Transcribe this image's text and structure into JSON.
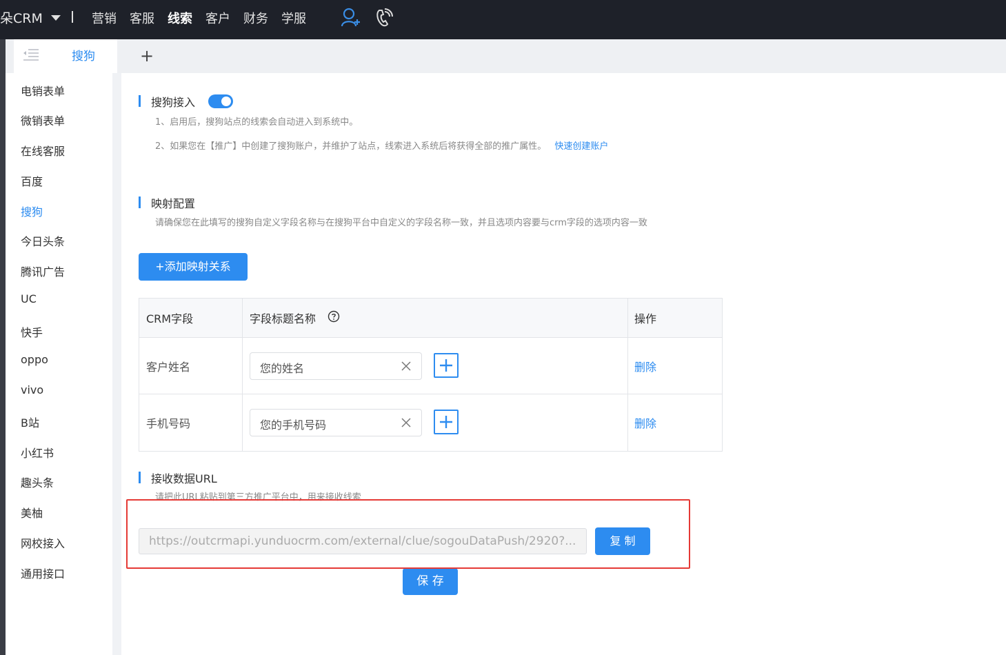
{
  "header": {
    "brand": "朵CRM",
    "nav": [
      "营销",
      "客服",
      "线索",
      "客户",
      "财务",
      "学服"
    ],
    "active_nav": "线索",
    "icons": [
      "add-user-icon",
      "phone-icon"
    ]
  },
  "tabs": {
    "active_label": "搜狗",
    "add_label": "+"
  },
  "sidebar": {
    "items": [
      "电销表单",
      "微销表单",
      "在线客服",
      "百度",
      "搜狗",
      "今日头条",
      "腾讯广告",
      "UC",
      "快手",
      "oppo",
      "vivo",
      "B站",
      "小红书",
      "趣头条",
      "美柚",
      "网校接入",
      "通用接口"
    ],
    "active": "搜狗"
  },
  "access": {
    "title": "搜狗接入",
    "enabled": true,
    "hint1": "1、启用后，搜狗站点的线索会自动进入到系统中。",
    "hint2": "2、如果您在【推广】中创建了搜狗账户，并维护了站点，线索进入系统后将获得全部的推广属性。",
    "quick_link": "快速创建账户"
  },
  "mapping": {
    "title": "映射配置",
    "hint": "请确保您在此填写的搜狗自定义字段名称与在搜狗平台中自定义的字段名称一致，并且选项内容要与crm字段的选项内容一致",
    "add_button": "+添加映射关系",
    "columns": [
      "CRM字段",
      "字段标题名称",
      "操作"
    ],
    "rows": [
      {
        "crm_field": "客户姓名",
        "title_value": "您的姓名",
        "action": "删除"
      },
      {
        "crm_field": "手机号码",
        "title_value": "您的手机号码",
        "action": "删除"
      }
    ]
  },
  "receive": {
    "title": "接收数据URL",
    "hint": "请把此URL粘贴到第三方推广平台中，用来接收线索",
    "url": "https://outcrmapi.yunduocrm.com/external/clue/sogouDataPush/2920?...",
    "copy_button": "复 制"
  },
  "save_button": "保 存",
  "colors": {
    "accent": "#2d8cf0",
    "topbar": "#1e2129",
    "highlight": "#e53935"
  }
}
